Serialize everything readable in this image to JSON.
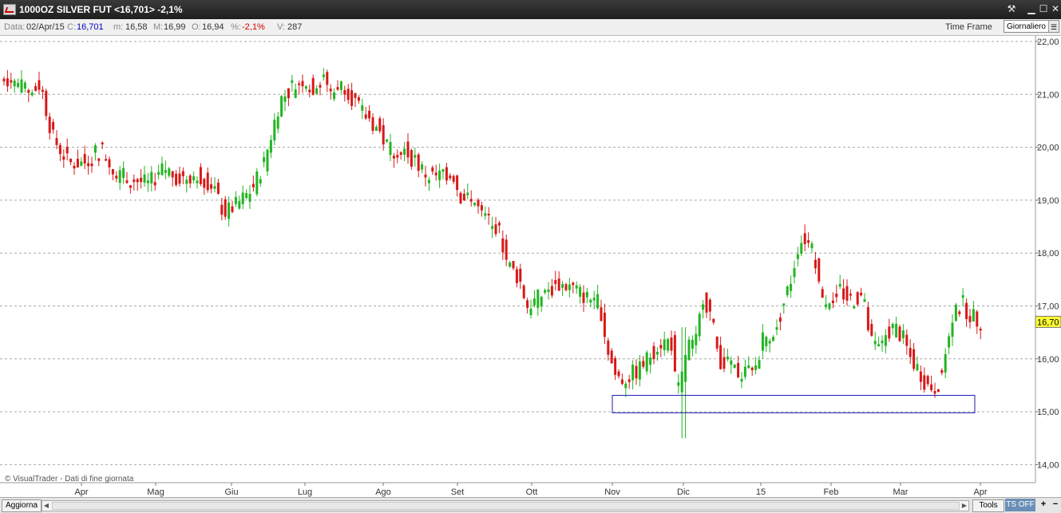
{
  "window": {
    "title": "1000OZ SILVER FUT <16,701> -2,1%",
    "buttons": [
      "tools-icon",
      "minimize-icon",
      "maximize-icon",
      "close-icon"
    ]
  },
  "infobar": {
    "date_label": "Data:",
    "date_value": "02/Apr/15",
    "close_label": "C:",
    "close_value": "16,701",
    "min_label": "m:",
    "min_value": "16,58",
    "max_label": "M:",
    "max_value": "16,99",
    "open_label": "O:",
    "open_value": "16,94",
    "pct_label": "%:",
    "pct_value": "-2,1%",
    "vol_label": "V:",
    "vol_value": "287",
    "timeframe_label": "Time Frame",
    "timeframe_value": "Giornaliero"
  },
  "chart_data": {
    "type": "candlestick",
    "ylim": [
      13.6,
      22.2
    ],
    "y_ticks": [
      "22,00",
      "21,00",
      "20,00",
      "19,00",
      "18,00",
      "17,00",
      "16,00",
      "15,00",
      "14,00"
    ],
    "x_ticks": [
      "Apr",
      "Mag",
      "Giu",
      "Lug",
      "Ago",
      "Set",
      "Ott",
      "Nov",
      "Dic",
      "15",
      "Feb",
      "Mar",
      "Apr"
    ],
    "last_price_label": "16,70",
    "last_price": 16.7,
    "up_color": "#22b522",
    "down_color": "#d81818",
    "grid": "dotted",
    "highlight_box": {
      "label": "support-zone",
      "x_from": "Nov",
      "x_to": "Mar-end",
      "y_low": 14.98,
      "y_high": 15.31
    },
    "path_points": [
      [
        0,
        21.3
      ],
      [
        20,
        21.3
      ],
      [
        40,
        21.0
      ],
      [
        55,
        21.2
      ],
      [
        70,
        20.2
      ],
      [
        90,
        19.7
      ],
      [
        110,
        19.7
      ],
      [
        130,
        20.0
      ],
      [
        150,
        19.5
      ],
      [
        170,
        19.4
      ],
      [
        190,
        19.3
      ],
      [
        210,
        19.6
      ],
      [
        230,
        19.4
      ],
      [
        250,
        19.5
      ],
      [
        270,
        19.3
      ],
      [
        285,
        18.75
      ],
      [
        300,
        18.9
      ],
      [
        320,
        19.2
      ],
      [
        335,
        19.7
      ],
      [
        345,
        20.3
      ],
      [
        355,
        20.9
      ],
      [
        370,
        21.1
      ],
      [
        385,
        21.3
      ],
      [
        395,
        21.1
      ],
      [
        408,
        21.4
      ],
      [
        420,
        21.0
      ],
      [
        435,
        21.2
      ],
      [
        455,
        20.7
      ],
      [
        475,
        20.4
      ],
      [
        490,
        20.0
      ],
      [
        505,
        20.05
      ],
      [
        520,
        19.8
      ],
      [
        540,
        19.45
      ],
      [
        560,
        19.45
      ],
      [
        570,
        19.6
      ],
      [
        580,
        19.1
      ],
      [
        600,
        18.95
      ],
      [
        610,
        18.6
      ],
      [
        620,
        18.65
      ],
      [
        630,
        18.4
      ],
      [
        640,
        17.8
      ],
      [
        655,
        17.5
      ],
      [
        665,
        17.0
      ],
      [
        675,
        17.1
      ],
      [
        690,
        17.3
      ],
      [
        705,
        17.4
      ],
      [
        720,
        17.35
      ],
      [
        740,
        17.15
      ],
      [
        755,
        17.1
      ],
      [
        765,
        16.2
      ],
      [
        775,
        15.7
      ],
      [
        785,
        15.6
      ],
      [
        795,
        15.7
      ],
      [
        805,
        15.8
      ],
      [
        815,
        16.0
      ],
      [
        830,
        16.3
      ],
      [
        845,
        16.35
      ],
      [
        852,
        15.3
      ],
      [
        858,
        15.6
      ],
      [
        865,
        16.3
      ],
      [
        875,
        16.2
      ],
      [
        885,
        17.2
      ],
      [
        895,
        16.8
      ],
      [
        905,
        16.0
      ],
      [
        920,
        15.8
      ],
      [
        935,
        15.7
      ],
      [
        950,
        15.8
      ],
      [
        960,
        16.4
      ],
      [
        975,
        16.5
      ],
      [
        985,
        17.0
      ],
      [
        995,
        17.5
      ],
      [
        1005,
        18.2
      ],
      [
        1015,
        18.3
      ],
      [
        1025,
        17.9
      ],
      [
        1035,
        17.0
      ],
      [
        1045,
        17.2
      ],
      [
        1055,
        17.3
      ],
      [
        1070,
        17.1
      ],
      [
        1085,
        17.2
      ],
      [
        1095,
        16.3
      ],
      [
        1105,
        16.2
      ],
      [
        1115,
        16.5
      ],
      [
        1125,
        16.6
      ],
      [
        1135,
        16.4
      ],
      [
        1145,
        16.0
      ],
      [
        1155,
        15.8
      ],
      [
        1165,
        15.5
      ],
      [
        1175,
        15.45
      ],
      [
        1185,
        15.8
      ],
      [
        1192,
        16.5
      ],
      [
        1200,
        17.0
      ],
      [
        1210,
        17.0
      ],
      [
        1222,
        16.8
      ],
      [
        1230,
        16.7
      ]
    ]
  },
  "watermark": "© VisualTrader - Dati di fine giornata",
  "statusbar": {
    "update_label": "Aggiorna",
    "tools_label": "Tools",
    "ts_label": "TS OFF",
    "zoom_in": "+",
    "zoom_out": "−"
  }
}
